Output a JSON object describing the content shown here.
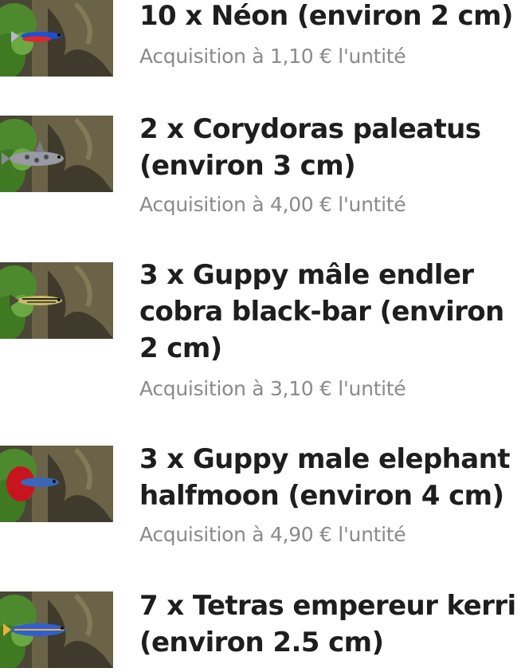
{
  "items": [
    {
      "name": "10 x Néon (environ 2 cm)",
      "price": "Acquisition à 1,10 € l'untité",
      "thumb_icon": "neon-tetra-photo",
      "fish_colors": [
        "#1d4fd6",
        "#e0262a"
      ]
    },
    {
      "name": "2 x Corydoras paleatus (environ 3 cm)",
      "price": "Acquisition à 4,00 € l'untité",
      "thumb_icon": "corydoras-photo",
      "fish_colors": [
        "#9a9aa4",
        "#4a4a55"
      ]
    },
    {
      "name": "3 x Guppy mâle endler cobra black-bar (environ 2 cm)",
      "price": "Acquisition à 3,10 € l'untité",
      "thumb_icon": "guppy-endler-photo",
      "fish_colors": [
        "#c9b86a",
        "#2b2b1e"
      ]
    },
    {
      "name": "3 x Guppy male elephant halfmoon (environ 4 cm)",
      "price": "Acquisition à 4,90 € l'untité",
      "thumb_icon": "guppy-halfmoon-photo",
      "fish_colors": [
        "#c8141e",
        "#3a67b8"
      ]
    },
    {
      "name": "7 x Tetras empereur kerri (environ 2.5 cm)",
      "price": "",
      "thumb_icon": "tetra-kerri-photo",
      "fish_colors": [
        "#2f5fd0",
        "#e8b23a"
      ]
    }
  ]
}
